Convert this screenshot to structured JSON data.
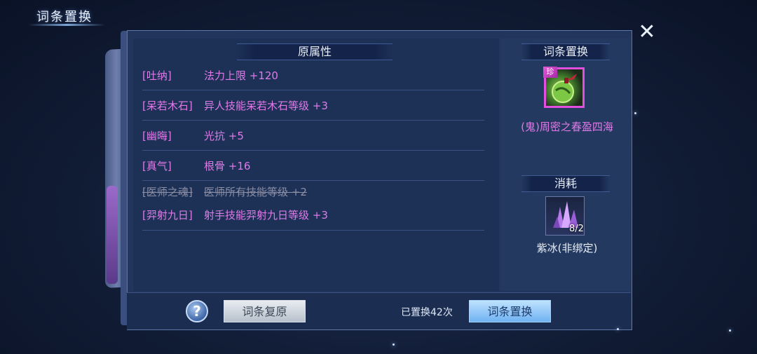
{
  "window": {
    "title": "词条置换",
    "close_icon": "close-icon"
  },
  "left_panel": {
    "header": "原属性",
    "rows": [
      {
        "key": "[吐纳]",
        "value": "法力上限 +120",
        "struck": false
      },
      {
        "key": "[呆若木石]",
        "value": "异人技能呆若木石等级 +3",
        "struck": false
      },
      {
        "key": "[幽晦]",
        "value": "光抗 +5",
        "struck": false
      },
      {
        "key": "[真气]",
        "value": "根骨 +16",
        "struck": false
      },
      {
        "key": "[医师之魂]",
        "value": "医师所有技能等级 +2",
        "struck": true
      },
      {
        "key": "[羿射九日]",
        "value": "射手技能羿射九日等级 +3",
        "struck": false
      }
    ]
  },
  "right_panel": {
    "header": "词条置换",
    "item": {
      "tag": "珍",
      "name": "(鬼)周密之春盈四海",
      "icon": "green-orb-icon"
    },
    "consume_header": "消耗",
    "consume": {
      "icon": "purple-crystal-icon",
      "count": "8/2",
      "name": "紫冰(非绑定)"
    }
  },
  "bottom": {
    "help_label": "?",
    "restore_label": "词条复原",
    "count_text": "已置换42次",
    "replace_label": "词条置换"
  },
  "colors": {
    "attribute_text": "#e07ae8",
    "struck_text": "#8d8fa6",
    "panel_bg": "#22365d",
    "button_blue": "#6fb2f2"
  }
}
